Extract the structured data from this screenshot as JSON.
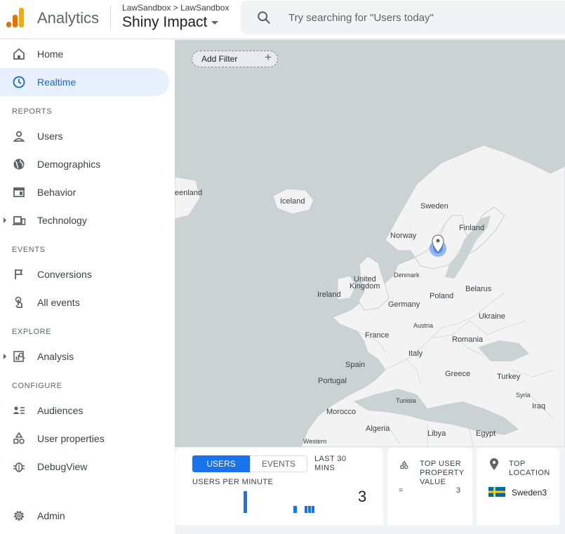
{
  "header": {
    "brand": "Analytics",
    "breadcrumb": "LawSandbox > LawSandbox",
    "property": "Shiny Impact",
    "search_placeholder": "Try searching for \"Users today\""
  },
  "sidebar": {
    "items": [
      {
        "label": "Home",
        "icon": "home-icon"
      },
      {
        "label": "Realtime",
        "icon": "clock-icon",
        "active": true
      }
    ],
    "reports_heading": "REPORTS",
    "reports": [
      {
        "label": "Users",
        "icon": "person-icon"
      },
      {
        "label": "Demographics",
        "icon": "globe-icon"
      },
      {
        "label": "Behavior",
        "icon": "window-icon"
      },
      {
        "label": "Technology",
        "icon": "devices-icon"
      }
    ],
    "events_heading": "EVENTS",
    "events": [
      {
        "label": "Conversions",
        "icon": "flag-icon"
      },
      {
        "label": "All events",
        "icon": "touch-icon"
      }
    ],
    "explore_heading": "EXPLORE",
    "explore": [
      {
        "label": "Analysis",
        "icon": "analysis-icon"
      }
    ],
    "configure_heading": "CONFIGURE",
    "configure": [
      {
        "label": "Audiences",
        "icon": "audience-icon"
      },
      {
        "label": "User properties",
        "icon": "shapes-icon"
      },
      {
        "label": "DebugView",
        "icon": "bug-icon"
      }
    ],
    "admin": {
      "label": "Admin",
      "icon": "gear-icon"
    }
  },
  "map": {
    "add_filter": "Add Filter",
    "labels": {
      "greenland": "eenland",
      "iceland": "Iceland",
      "sweden": "Sweden",
      "norway": "Norway",
      "finland": "Finland",
      "denmark": "Denmark",
      "united_kingdom_1": "United",
      "united_kingdom_2": "Kingdom",
      "ireland": "Ireland",
      "belarus": "Belarus",
      "poland": "Poland",
      "germany": "Germany",
      "ukraine": "Ukraine",
      "austria": "Austria",
      "france": "France",
      "romania": "Romania",
      "italy": "Italy",
      "spain": "Spain",
      "portugal": "Portugal",
      "greece": "Greece",
      "turkey": "Turkey",
      "syria": "Syria",
      "iraq": "Iraq",
      "tunisia": "Tunisia",
      "morocco": "Morocco",
      "algeria": "Algeria",
      "libya": "Libya",
      "egypt": "Egypt",
      "western": "Western"
    }
  },
  "cards": {
    "users_tab": "USERS",
    "events_tab": "EVENTS",
    "range_line1": "LAST 30",
    "range_line2": "MINS",
    "users_per_minute": "USERS PER MINUTE",
    "users_count": "3",
    "user_minute_bars": [
      3,
      0,
      0,
      0,
      0,
      0,
      0,
      0,
      0,
      0,
      0,
      0,
      0,
      0,
      1,
      0,
      0,
      1,
      1,
      1
    ],
    "top_property_1": "TOP USER",
    "top_property_2": "PROPERTY",
    "top_property_3": "VALUE",
    "top_property_key": "=",
    "top_property_value": "3",
    "top_location_1": "TOP",
    "top_location_2": "LOCATION",
    "top_location_name": "Sweden",
    "top_location_value": "3"
  },
  "colors": {
    "accent": "#1a73e8",
    "active_bg": "#e8f0fe",
    "map_water": "#cad2d3",
    "map_land": "#f3f3f3",
    "logo_orange": "#f9ab00",
    "logo_dark_orange": "#e37400",
    "sweden_blue": "#006aa7",
    "sweden_yellow": "#fecc00"
  }
}
